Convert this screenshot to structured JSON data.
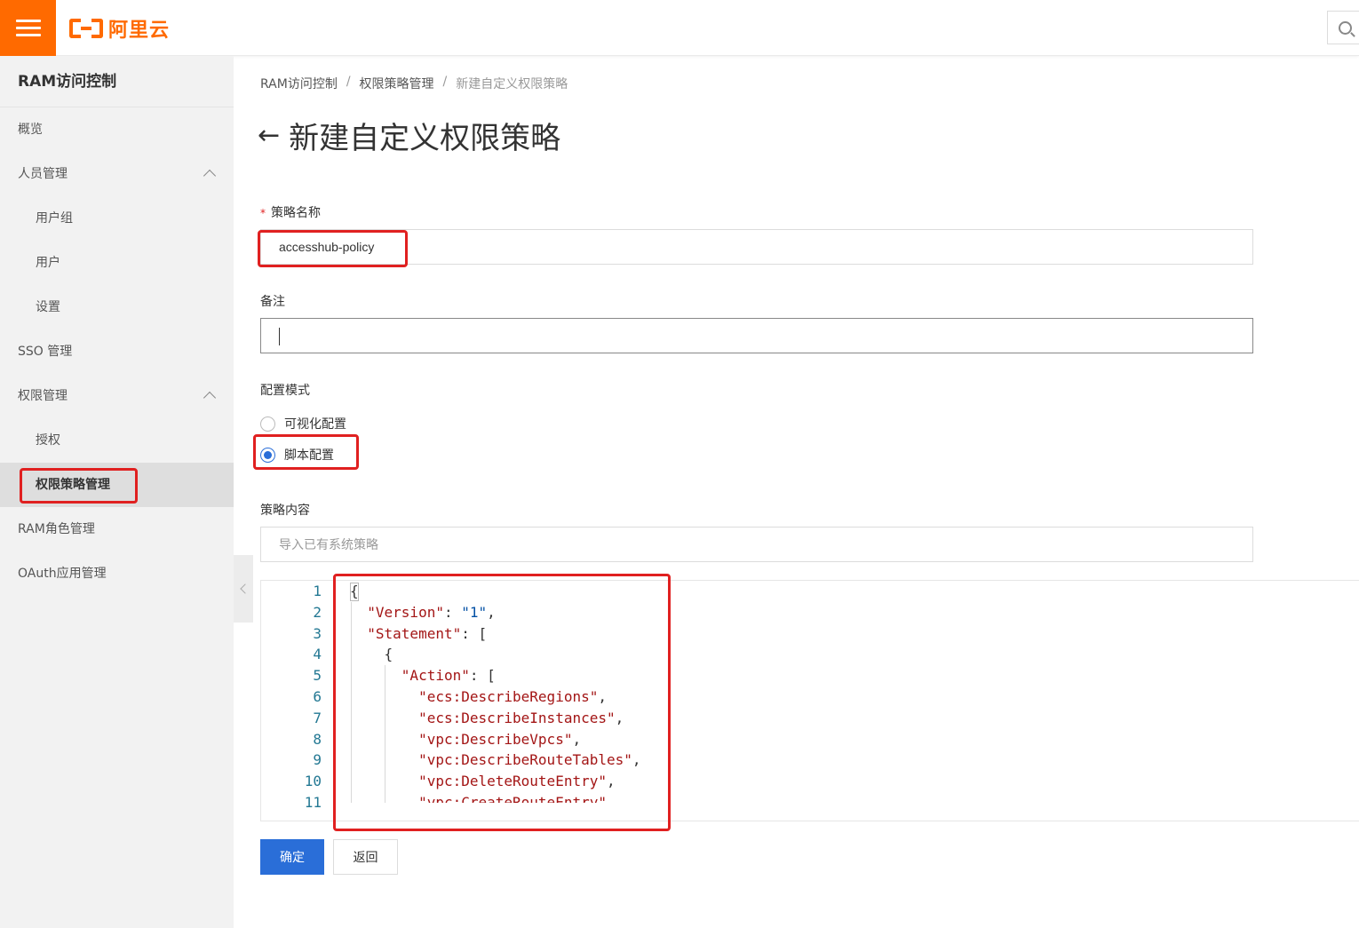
{
  "header": {
    "logo_text": "阿里云",
    "logo_icon": "aliyun-logo-icon",
    "menu_icon": "hamburger-menu-icon",
    "search_icon": "search-icon"
  },
  "sidebar": {
    "title": "RAM访问控制",
    "items": [
      {
        "label": "概览"
      },
      {
        "label": "人员管理"
      },
      {
        "label": "用户组"
      },
      {
        "label": "用户"
      },
      {
        "label": "设置"
      },
      {
        "label": "SSO 管理"
      },
      {
        "label": "权限管理"
      },
      {
        "label": "授权"
      },
      {
        "label": "权限策略管理"
      },
      {
        "label": "RAM角色管理"
      },
      {
        "label": "OAuth应用管理"
      }
    ]
  },
  "breadcrumb": [
    "RAM访问控制",
    "权限策略管理",
    "新建自定义权限策略"
  ],
  "page": {
    "title": "新建自定义权限策略"
  },
  "form": {
    "policy_name": {
      "required_mark": "*",
      "label": "策略名称",
      "value": "accesshub-policy"
    },
    "remark": {
      "label": "备注",
      "value": ""
    },
    "mode": {
      "label": "配置模式",
      "options": [
        "可视化配置",
        "脚本配置"
      ],
      "selected": "脚本配置"
    },
    "content": {
      "label": "策略内容",
      "import_placeholder": "导入已有系统策略"
    }
  },
  "editor": {
    "line_numbers": [
      "1",
      "2",
      "3",
      "4",
      "5",
      "6",
      "7",
      "8",
      "9",
      "10",
      "11"
    ],
    "lines": [
      "{",
      "  \"Version\": \"1\",",
      "  \"Statement\": [",
      "    {",
      "      \"Action\": [",
      "        \"ecs:DescribeRegions\",",
      "        \"ecs:DescribeInstances\",",
      "        \"vpc:DescribeVpcs\",",
      "        \"vpc:DescribeRouteTables\",",
      "        \"vpc:DeleteRouteEntry\",",
      "        \"vpc:CreateRouteEntry\","
    ]
  },
  "buttons": {
    "confirm": "确定",
    "back": "返回"
  },
  "colors": {
    "brand": "#ff6a00",
    "primary": "#2a6ed8",
    "highlight": "#e02020"
  }
}
